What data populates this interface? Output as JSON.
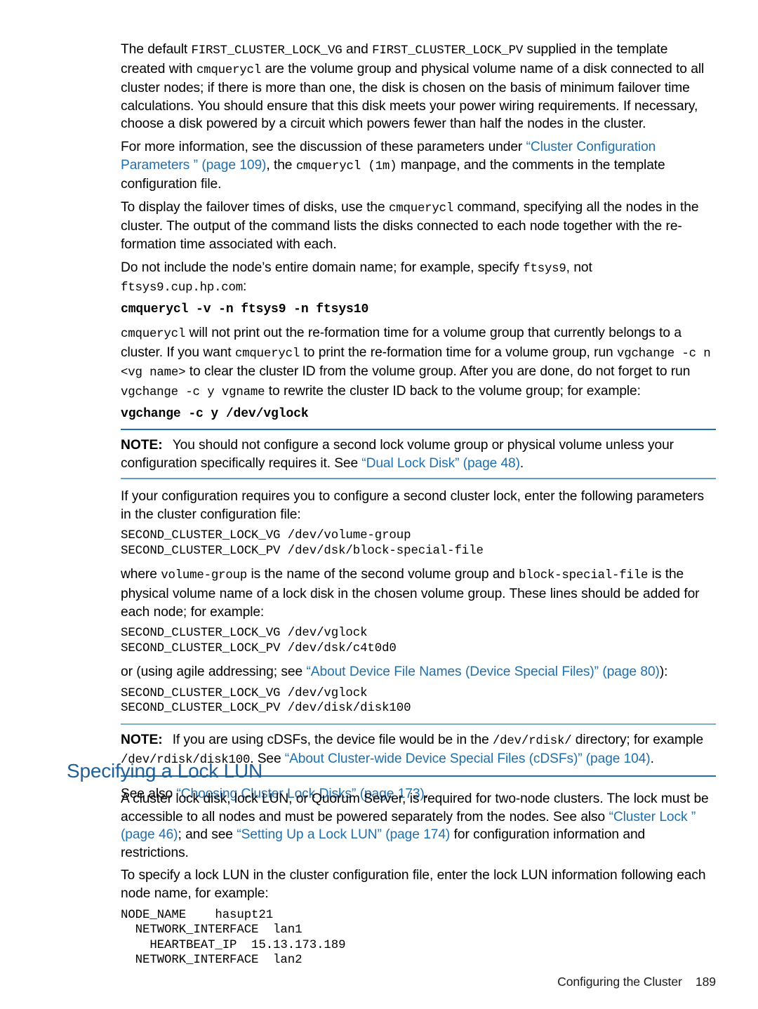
{
  "colors": {
    "link": "#1f6fad",
    "heading": "#1f6099",
    "rule_dark": "#1f6fad",
    "rule_light": "#7bb0cb",
    "text": "#000000"
  },
  "paragraphs": {
    "p1_a": "The default ",
    "p1_code1": "FIRST_CLUSTER_LOCK_VG",
    "p1_b": " and ",
    "p1_code2": "FIRST_CLUSTER_LOCK_PV",
    "p1_c": " supplied in the template created with ",
    "p1_code3": "cmquerycl",
    "p1_d": " are the volume group and physical volume name of a disk connected to all cluster nodes; if there is more than one, the disk is chosen on the basis of minimum failover time calculations. You should ensure that this disk meets your power wiring requirements. If necessary, choose a disk powered by a circuit which powers fewer than half the nodes in the cluster.",
    "p2_a": "For more information, see the discussion of these parameters under ",
    "p2_link": "“Cluster Configuration Parameters ” (page 109)",
    "p2_b": ", the ",
    "p2_code": "cmquerycl (1m)",
    "p2_c": " manpage, and the comments in the template configuration file.",
    "p3_a": "To display the failover times of disks, use the ",
    "p3_code": "cmquerycl",
    "p3_b": " command, specifying all the nodes in the cluster. The output of the command lists the disks connected to each node together with the re-formation time associated with each.",
    "p4_a": "Do not include the node’s entire domain name; for example, specify ",
    "p4_code1": "ftsys9",
    "p4_b": ", not ",
    "p4_code2": "ftsys9.cup.hp.com",
    "p4_c": ":",
    "cmd1": "cmquerycl -v -n ftsys9 -n ftsys10",
    "p5_code1": "cmquerycl",
    "p5_a": " will not print out the re-formation time for a volume group that currently belongs to a cluster. If you want ",
    "p5_code2": "cmquerycl",
    "p5_b": " to print the re-formation time for a volume group, run ",
    "p5_code3": "vgchange -c n <vg name>",
    "p5_c": " to clear the cluster ID from the volume group. After you are done, do not forget to run ",
    "p5_code4": "vgchange -c y vgname",
    "p5_d": " to rewrite the cluster ID back to the volume group; for example:",
    "cmd2": "vgchange -c y /dev/vglock",
    "note1_label": "NOTE:",
    "note1_a": "You should not configure a second lock volume group or physical volume unless your configuration specifically requires it. See ",
    "note1_link": "“Dual Lock Disk” (page 48)",
    "note1_b": ".",
    "p6": "If your configuration requires you to configure a second cluster lock, enter the following parameters in the cluster configuration file:",
    "code1": "SECOND_CLUSTER_LOCK_VG /dev/volume-group\nSECOND_CLUSTER_LOCK_PV /dev/dsk/block-special-file",
    "p7_a": "where ",
    "p7_code1": "volume-group",
    "p7_b": " is the name of the second volume group and ",
    "p7_code2": "block-special-file",
    "p7_c": " is the physical volume name of a lock disk in the chosen volume group. These lines should be added for each node; for example:",
    "code2": "SECOND_CLUSTER_LOCK_VG /dev/vglock\nSECOND_CLUSTER_LOCK_PV /dev/dsk/c4t0d0",
    "p8_a": "or (using agile addressing; see ",
    "p8_link": "“About Device File Names (Device Special Files)” (page 80)",
    "p8_b": "):",
    "code3": "SECOND_CLUSTER_LOCK_VG /dev/vglock\nSECOND_CLUSTER_LOCK_PV /dev/disk/disk100",
    "note2_label": "NOTE:",
    "note2_a": "If you are using cDSFs, the device file would be in the ",
    "note2_code1": "/dev/rdisk/",
    "note2_b": " directory; for example ",
    "note2_code2": "/dev/rdisk/disk100",
    "note2_c": ". See ",
    "note2_link": "“About Cluster-wide Device Special Files (cDSFs)” (page 104)",
    "note2_d": ".",
    "p9_a": "See also ",
    "p9_link": "“Choosing Cluster Lock Disks” (page 173)",
    "p9_b": ".",
    "section_title": "Specifying a Lock LUN",
    "p10_a": "A cluster lock disk, lock LUN, or Quorum Server, is required for two-node clusters. The lock must be accessible to all nodes and must be powered separately from the nodes. See also ",
    "p10_link1": "“Cluster Lock ” (page 46)",
    "p10_b": "; and see ",
    "p10_link2": "“Setting Up a Lock LUN” (page 174)",
    "p10_c": " for configuration information and restrictions.",
    "p11": "To specify a lock LUN in the cluster configuration file, enter the lock LUN information following each node name, for example:",
    "code4": "NODE_NAME    hasupt21\n  NETWORK_INTERFACE  lan1\n    HEARTBEAT_IP  15.13.173.189\n  NETWORK_INTERFACE  lan2"
  },
  "footer": {
    "text": "Configuring the Cluster    189"
  }
}
